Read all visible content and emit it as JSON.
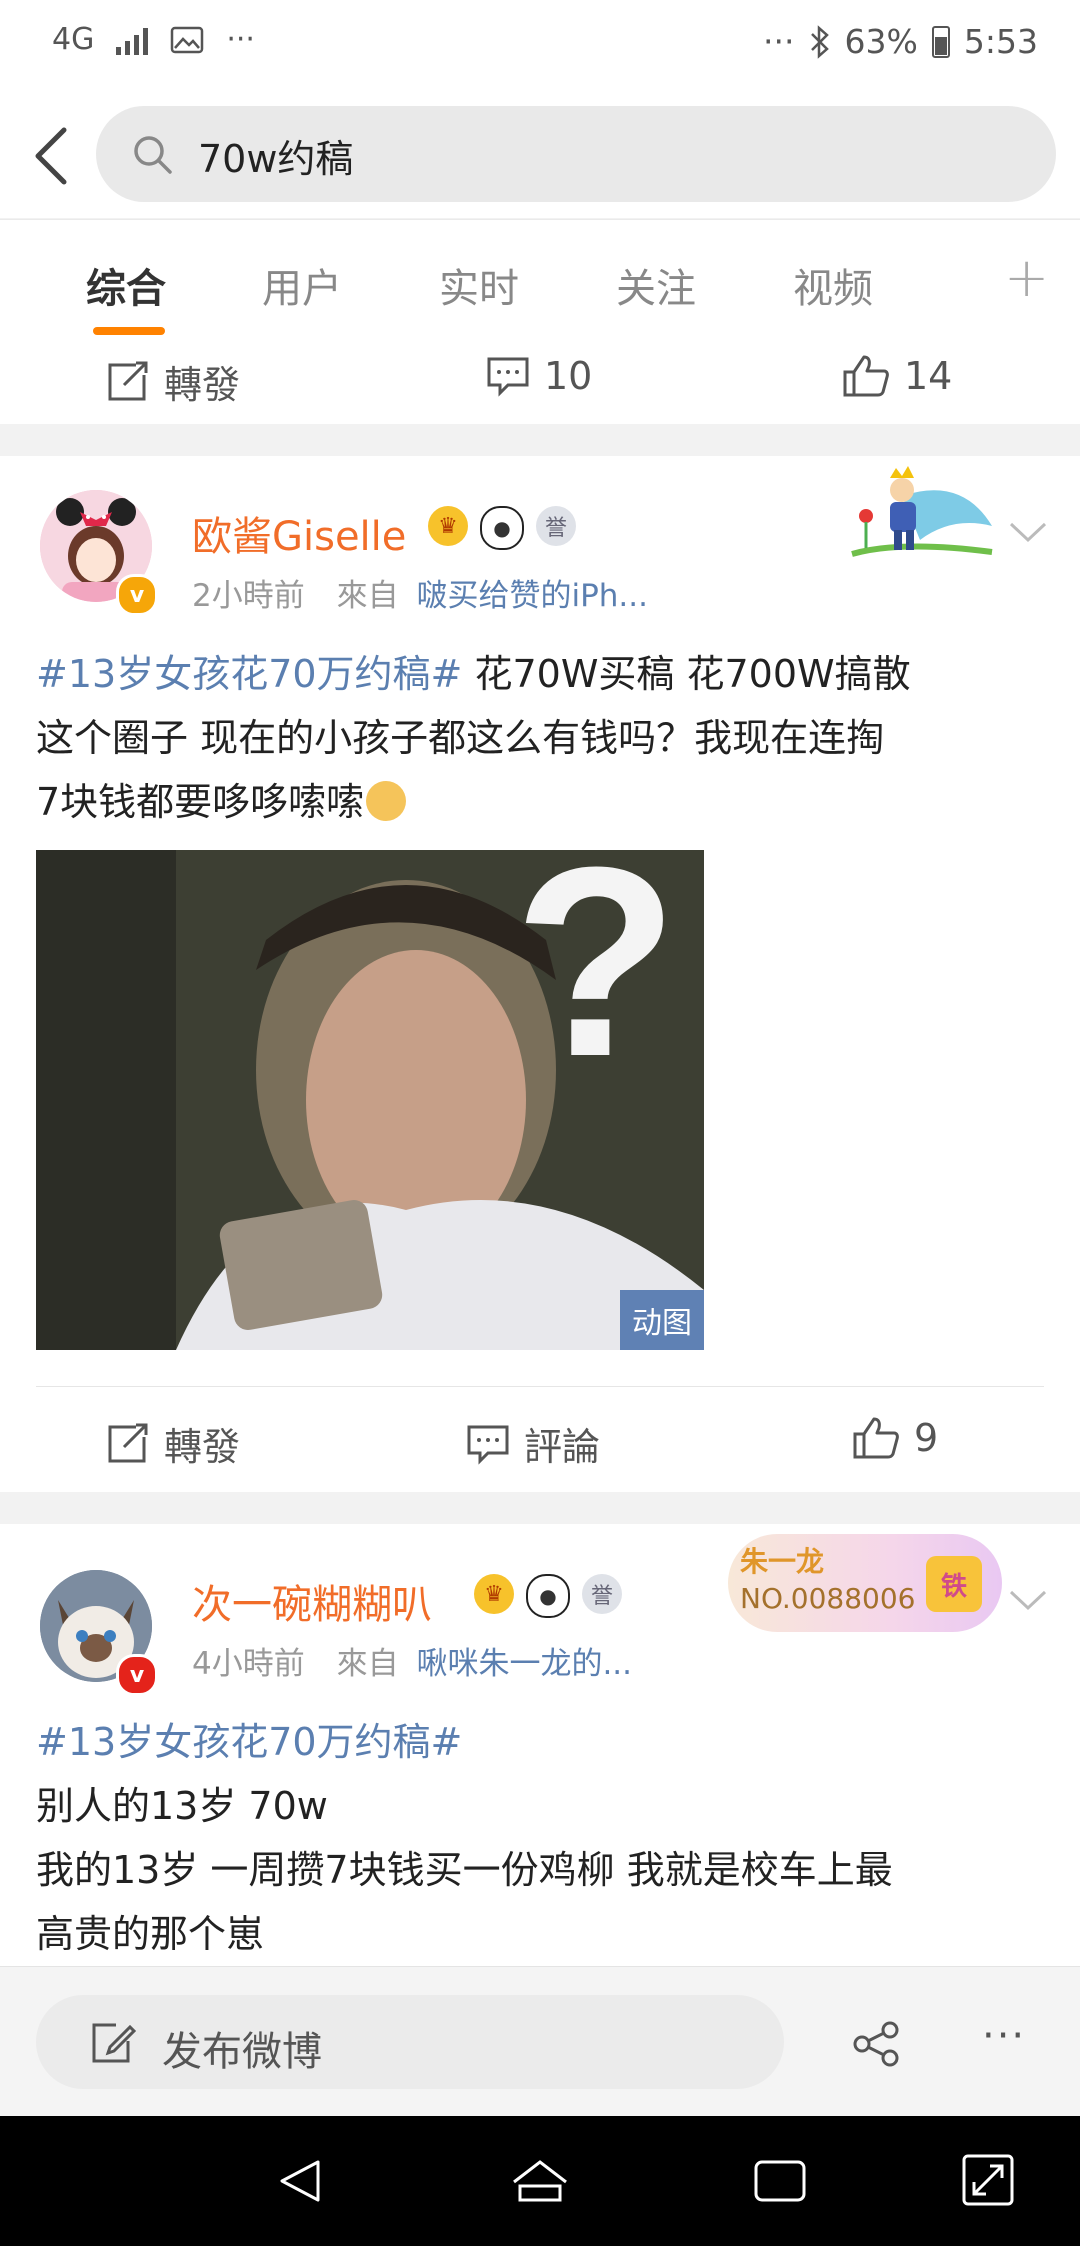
{
  "status_bar": {
    "network": "4G",
    "more": "···",
    "right_more": "···",
    "battery": "63%",
    "time": "5:53"
  },
  "search": {
    "query": "70w约稿"
  },
  "tabs": [
    {
      "label": "综合",
      "active": true
    },
    {
      "label": "用户"
    },
    {
      "label": "实时"
    },
    {
      "label": "关注"
    },
    {
      "label": "视频"
    }
  ],
  "prev_post_actions": {
    "repost": "轉發",
    "comments": "10",
    "likes": "14"
  },
  "posts": [
    {
      "username": "欧酱Giselle",
      "time": "2小時前",
      "source_prefix": "來自",
      "source": "啵买给赞的iPh...",
      "topic": "#13岁女孩花70万约稿#",
      "text_line1": " 花70W买稿 花700W搞散",
      "text_line2": "这个圈子 现在的小孩子都这么有钱吗？我现在连掏",
      "text_line3": "7块钱都要哆哆嗦嗦",
      "image_tag": "动图",
      "actions": {
        "repost": "轉發",
        "comment": "評論",
        "likes": "9"
      }
    },
    {
      "username": "次一碗糊糊叭",
      "time": "4小時前",
      "source_prefix": "來自",
      "source": "啾咪朱一龙的...",
      "topic": "#13岁女孩花70万约稿#",
      "text_line1": "别人的13岁 70w",
      "text_line2": "我的13岁 一周攒7块钱买一份鸡柳 我就是校车上最",
      "text_line3": "高贵的那个崽",
      "fan_card": {
        "name": "朱一龙",
        "number": "NO.0088006",
        "crown_text": "铁"
      }
    }
  ],
  "compose": {
    "label": "发布微博"
  },
  "colors": {
    "accent": "#ff8200",
    "username": "#f16d29",
    "link": "#5b7fb0"
  }
}
